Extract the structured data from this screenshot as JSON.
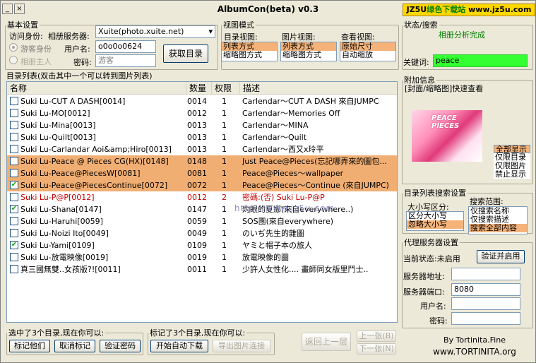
{
  "window": {
    "title": "AlbumCon(beta) v0.3",
    "brand_prefix": "JZ5U",
    "brand_green": "绿色下载站",
    "brand_url": "www.jz5u.com"
  },
  "basic": {
    "legend": "基本设置",
    "identity_label": "访问身份:",
    "guest": "游客身份",
    "owner": "相册主人",
    "server_label": "相册服务器:",
    "server_value": "Xuite(photo.xuite.net)",
    "username_label": "用户名:",
    "username_value": "o0o0o0624",
    "password_label": "密码:",
    "password_placeholder": "游客",
    "fetch_button": "获取目录"
  },
  "view": {
    "legend": "视图模式",
    "dir_label": "目录视图:",
    "dir_options": [
      "列表方式",
      "缩略图方式"
    ],
    "img_label": "图片视图:",
    "img_options": [
      "列表方式",
      "缩略图方式"
    ],
    "look_label": "查看视图:",
    "look_options": [
      "原始尺寸",
      "自动缩放"
    ]
  },
  "status": {
    "legend": "状态/搜索",
    "message": "相册分析完成",
    "keyword_label": "关键词:",
    "keyword_value": "peace",
    "accent": "#33ff33"
  },
  "list": {
    "legend": "目录列表(双击其中一个可以转到图片列表)",
    "columns": [
      "名称",
      "数量",
      "权限",
      "描述"
    ],
    "rows": [
      {
        "checked": false,
        "name": "Suki Lu-CUT A DASH[0014]",
        "count": "0014",
        "perm": "1",
        "desc": "Carlendar～CUT A DASH 來自JUMPC",
        "hl": false,
        "red": false
      },
      {
        "checked": false,
        "name": "Suki Lu-MO[0012]",
        "count": "0012",
        "perm": "1",
        "desc": "Carlendar～Memories Off",
        "hl": false,
        "red": false
      },
      {
        "checked": false,
        "name": "Suki Lu-Mina[0013]",
        "count": "0013",
        "perm": "1",
        "desc": "Carlendar～MINA",
        "hl": false,
        "red": false
      },
      {
        "checked": false,
        "name": "Suki Lu-Quilt[0013]",
        "count": "0013",
        "perm": "1",
        "desc": "Carlendar～Quilt",
        "hl": false,
        "red": false
      },
      {
        "checked": false,
        "name": "Suki Lu-Carlandar Aoi&amp;Hiro[0013]",
        "count": "0013",
        "perm": "1",
        "desc": "Carlendar～西又x玲平",
        "hl": false,
        "red": false
      },
      {
        "checked": false,
        "name": "Suki Lu-Peace @ Pieces CG(HX)[0148]",
        "count": "0148",
        "perm": "1",
        "desc": "Just Peace@Pieces(忘記哪弄來的圖包...",
        "hl": true,
        "red": false
      },
      {
        "checked": false,
        "name": "Suki Lu-Peace@PiecesW[0081]",
        "count": "0081",
        "perm": "1",
        "desc": "Peace@Pieces～wallpaper",
        "hl": true,
        "red": false
      },
      {
        "checked": true,
        "name": "Suki Lu-Peace@PiecesContinue[0072]",
        "count": "0072",
        "perm": "1",
        "desc": "Peace@Pieces～Continue (來自JUMPC)",
        "hl": true,
        "red": false
      },
      {
        "checked": false,
        "name": "Suki Lu-P@P[0012]",
        "count": "0012",
        "perm": "2",
        "desc": "密碼:(否) Suki Lu-P@P",
        "hl": false,
        "red": true
      },
      {
        "checked": true,
        "name": "Suki Lu-Shana[0147]",
        "count": "0147",
        "perm": "1",
        "desc": "灼眼的夏娜(來自everywhere..)",
        "hl": false,
        "red": false
      },
      {
        "checked": false,
        "name": "Suki Lu-Haruhi[0059]",
        "count": "0059",
        "perm": "1",
        "desc": "SOS團(來自everywhere)",
        "hl": false,
        "red": false
      },
      {
        "checked": false,
        "name": "Suki Lu-Noizi Ito[0049]",
        "count": "0049",
        "perm": "1",
        "desc": "のいぢ先生的雜圖",
        "hl": false,
        "red": false
      },
      {
        "checked": true,
        "name": "Suki Lu-Yami[0109]",
        "count": "0109",
        "perm": "1",
        "desc": "ヤミと帽子本の旅人",
        "hl": false,
        "red": false
      },
      {
        "checked": false,
        "name": "Suki Lu-放電映像[0019]",
        "count": "0019",
        "perm": "1",
        "desc": "放電映像的圖",
        "hl": false,
        "red": false
      },
      {
        "checked": false,
        "name": "真三國無雙..女孩版?![0011]",
        "count": "0011",
        "perm": "1",
        "desc": "少許人女性化.... 畫師同女版里鬥士..",
        "hl": false,
        "red": false
      }
    ],
    "watermark": "http://www.jz5u.com"
  },
  "extra": {
    "legend": "附加信息",
    "preview_title": "[封面/缩略图]快速查看",
    "thumb_text": "PEACE PIECES",
    "filter_options": [
      "全部显示",
      "仅限目录",
      "仅限图片",
      "禁止显示"
    ]
  },
  "search": {
    "legend": "目录列表搜索设置",
    "case_label": "大小写区分:",
    "case_options": [
      "区分大小写",
      "忽略大小写"
    ],
    "scope_label": "搜索范围:",
    "scope_options": [
      "仅搜索名称",
      "仅搜索描述",
      "搜索全部内容"
    ]
  },
  "proxy": {
    "legend": "代理服务器设置",
    "state_label": "当前状态:未启用",
    "verify_button": "验证并启用",
    "addr_label": "服务器地址:",
    "addr_value": "",
    "port_label": "服务器端口:",
    "port_value": "8080",
    "user_label": "用户名:",
    "pass_label": "密码:"
  },
  "footer": {
    "selected_legend": "选中了3个目录,现在你可以:",
    "mark_dirs": "标记他们",
    "unmark": "取消标记",
    "verify_pwd": "验证密码",
    "marked_legend": "标记了3个目录,现在你可以:",
    "start_download": "开始自动下载",
    "export_links": "导出图片连接",
    "back": "返回上一层",
    "prev": "上一张(B)",
    "next": "下一张(N)",
    "credit1": "By Tortinita.Fine",
    "credit2": "www.TORTINITA.org"
  }
}
